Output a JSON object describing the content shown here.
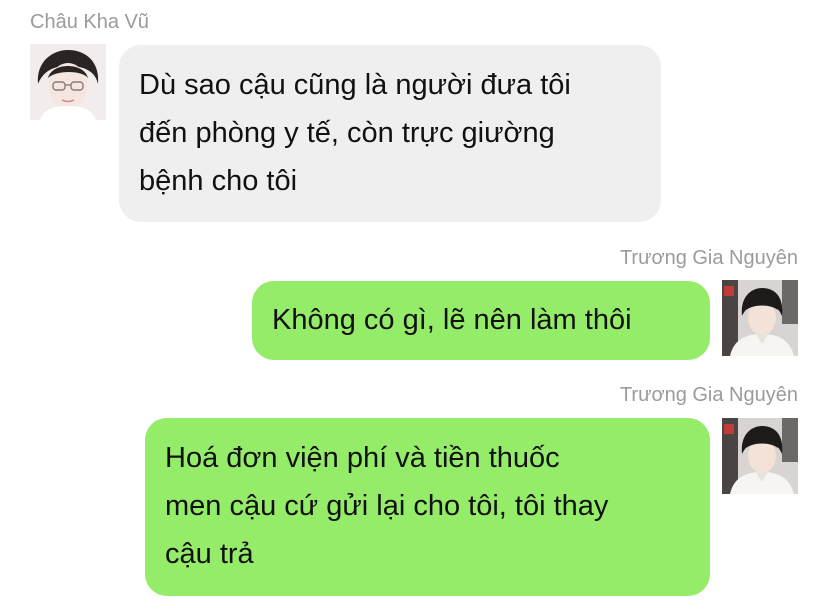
{
  "chat": {
    "messages": [
      {
        "sender": "Châu Kha Vũ",
        "direction": "incoming",
        "avatar": "avatar-chau-kha-vu",
        "lines": [
          "Dù sao cậu cũng là người đưa tôi",
          "đến phòng y tế, còn trực giường",
          "bệnh cho tôi"
        ]
      },
      {
        "sender": "Trương Gia Nguyên",
        "direction": "outgoing",
        "avatar": "avatar-truong-gia-nguyen",
        "lines": [
          "Không có gì, lẽ nên làm thôi"
        ]
      },
      {
        "sender": "Trương Gia Nguyên",
        "direction": "outgoing",
        "avatar": "avatar-truong-gia-nguyen",
        "lines": [
          "Hoá đơn viện phí và tiền thuốc",
          "men cậu cứ gửi lại cho tôi, tôi thay",
          "cậu trả"
        ]
      }
    ]
  },
  "colors": {
    "incoming_bubble": "#efefef",
    "outgoing_bubble": "#95ec69",
    "name_text": "#9b9b9b",
    "message_text": "#111111"
  }
}
